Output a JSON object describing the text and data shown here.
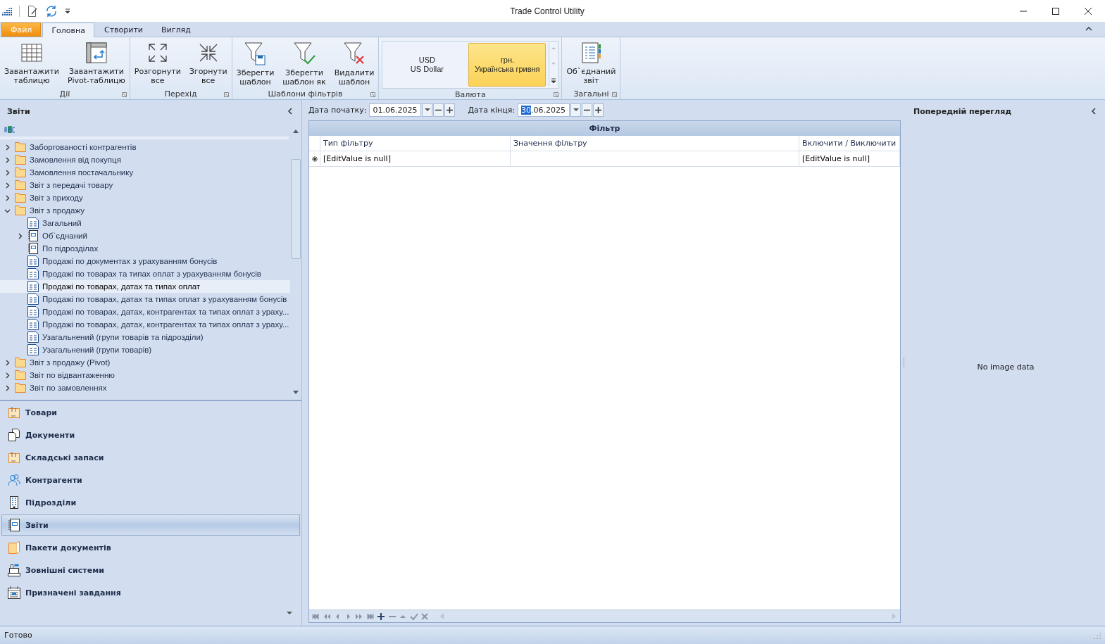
{
  "window": {
    "title": "Trade Control Utility"
  },
  "ribbon_tabs": [
    {
      "label": "Файл",
      "kind": "file",
      "selected": false
    },
    {
      "label": "Головна",
      "kind": "tab",
      "selected": true
    },
    {
      "label": "Створити",
      "kind": "tab",
      "selected": false
    },
    {
      "label": "Вигляд",
      "kind": "tab",
      "selected": false
    }
  ],
  "ribbon_groups": [
    {
      "title": "Дії",
      "buttons": [
        {
          "label": "Завантажити\nтаблицю",
          "kind": "table"
        },
        {
          "label": "Завантажити\nPivot-таблицю",
          "kind": "pivot"
        }
      ]
    },
    {
      "title": "Перехід",
      "buttons": [
        {
          "label": "Розгорнути\nвсе",
          "kind": "expand"
        },
        {
          "label": "Згорнути\nвсе",
          "kind": "collapse"
        }
      ]
    },
    {
      "title": "Шаблони фільтрів",
      "buttons": [
        {
          "label": "Зберегти\nшаблон",
          "kind": "save"
        },
        {
          "label": "Зберегти\nшаблон як",
          "kind": "save-as"
        },
        {
          "label": "Видалити\nшаблон",
          "kind": "delete"
        }
      ]
    },
    {
      "title": "Валюта",
      "currencies": [
        {
          "code": "USD",
          "name": "US Dollar",
          "selected": false
        },
        {
          "code": "грн.",
          "name": "Українська гривня",
          "selected": true
        }
      ]
    },
    {
      "title": "Загальні",
      "buttons": [
        {
          "label": "Об`єднаний\nзвіт",
          "kind": "combined"
        }
      ]
    }
  ],
  "reports_panel": {
    "title": "Звіти",
    "tree": [
      {
        "label": "Заборгованості контрагентів",
        "kind": "folder",
        "expanded": false,
        "selected": false
      },
      {
        "label": "Замовлення від покупця",
        "kind": "folder",
        "expanded": false,
        "selected": false
      },
      {
        "label": "Замовлення постачальнику",
        "kind": "folder",
        "expanded": false,
        "selected": false
      },
      {
        "label": "Звіт з передачі товару",
        "kind": "folder",
        "expanded": false,
        "selected": false
      },
      {
        "label": "Звіт з приходу",
        "kind": "folder",
        "expanded": false,
        "selected": false
      },
      {
        "label": "Звіт з продажу",
        "kind": "folder",
        "expanded": true,
        "selected": false,
        "children": [
          {
            "label": "Загальний",
            "kind": "report",
            "selected": false
          },
          {
            "label": "Об`єднаний",
            "kind": "notebook",
            "expanded": false,
            "selected": false
          },
          {
            "label": "По підрозділах",
            "kind": "notebook",
            "selected": false
          },
          {
            "label": "Продажі по документах з урахуванням бонусів",
            "kind": "report",
            "selected": false
          },
          {
            "label": "Продажі по товарах та типах оплат з урахуванням бонусів",
            "kind": "report",
            "selected": false
          },
          {
            "label": "Продажі по товарах, датах та типах оплат",
            "kind": "report",
            "selected": true
          },
          {
            "label": "Продажі по товарах, датах та типах оплат з урахуванням бонусів",
            "kind": "report",
            "selected": false
          },
          {
            "label": "Продажі по товарах, датах, контрагентах та типах оплат з ураху...",
            "kind": "report",
            "selected": false
          },
          {
            "label": "Продажі по товарах, датах, контрагентах та типах оплат з ураху...",
            "kind": "report",
            "selected": false
          },
          {
            "label": "Узагальнений (групи товарів та підрозділи)",
            "kind": "report",
            "selected": false
          },
          {
            "label": "Узагальнений (групи товарів)",
            "kind": "report",
            "selected": false
          }
        ]
      },
      {
        "label": "Звіт з продажу (Pivot)",
        "kind": "folder",
        "expanded": false,
        "selected": false
      },
      {
        "label": "Звіт по відвантаженню",
        "kind": "folder",
        "expanded": false,
        "selected": false
      },
      {
        "label": "Звіт по замовленнях",
        "kind": "folder",
        "expanded": false,
        "selected": false
      }
    ]
  },
  "navigation": [
    {
      "label": "Товари",
      "kind": "box",
      "selected": false
    },
    {
      "label": "Документи",
      "kind": "documents",
      "selected": false
    },
    {
      "label": "Складські запаси",
      "kind": "box",
      "selected": false
    },
    {
      "label": "Контрагенти",
      "kind": "people",
      "selected": false
    },
    {
      "label": "Підрозділи",
      "kind": "building",
      "selected": false
    },
    {
      "label": "Звіти",
      "kind": "notebook",
      "selected": true
    },
    {
      "label": "Пакети документів",
      "kind": "folder",
      "selected": false
    },
    {
      "label": "Зовнішні системи",
      "kind": "register",
      "selected": false
    },
    {
      "label": "Призначені завдання",
      "kind": "calendar",
      "selected": false
    }
  ],
  "start_date": {
    "label": "Дата початку:",
    "value": "01.06.2025"
  },
  "end_date": {
    "label": "Дата кінця:",
    "value": "30.06.2025"
  },
  "filter_grid": {
    "title": "Фільтр",
    "columns": [
      "Тип фільтру",
      "Значення фільтру",
      "Включити / Виключити"
    ],
    "rows": [
      {
        "new_row": true,
        "cells": [
          "[EditValue is null]",
          "",
          "[EditValue is null]"
        ]
      }
    ]
  },
  "preview": {
    "title": "Попередній перегляд",
    "message": "No image data"
  },
  "status_bar": {
    "text": "Готово"
  }
}
